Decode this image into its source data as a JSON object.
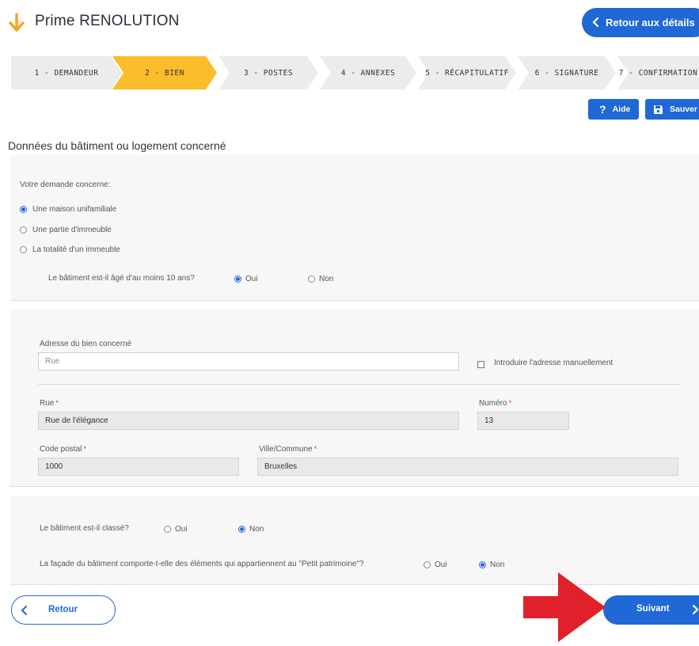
{
  "header": {
    "title": "Prime RENOLUTION",
    "back_details_label": "Retour aux détails"
  },
  "steps": [
    {
      "label": "1 - DEMANDEUR",
      "active": false
    },
    {
      "label": "2 - BIEN",
      "active": true
    },
    {
      "label": "3 - POSTES",
      "active": false
    },
    {
      "label": "4 - ANNEXES",
      "active": false
    },
    {
      "label": "5 - RÉCAPITULATIF",
      "active": false
    },
    {
      "label": "6 - SIGNATURE",
      "active": false
    },
    {
      "label": "7 - CONFIRMATION",
      "active": false
    }
  ],
  "toolbar": {
    "help_label": "Aide",
    "save_label": "Sauver"
  },
  "section_title": "Données du bâtiment ou logement concerné",
  "concern": {
    "label": "Votre demande concerne:",
    "options": [
      {
        "label": "Une maison unifamiliale",
        "selected": true
      },
      {
        "label": "Une partie d'immeuble",
        "selected": false
      },
      {
        "label": "La totalité d'un immeuble",
        "selected": false
      }
    ]
  },
  "age_question": {
    "label": "Le bâtiment est-il âgé d'au moins 10 ans?",
    "yes": "Oui",
    "no": "Non",
    "value": "Oui"
  },
  "address": {
    "label": "Adresse du bien concerné",
    "placeholder": "Rue",
    "manual_label": "Introduire l'adresse manuellement",
    "street_label": "Rue",
    "street_value": "Rue de l'élégance",
    "number_label": "Numéro",
    "number_value": "13",
    "postal_label": "Code postal",
    "postal_value": "1000",
    "city_label": "Ville/Commune",
    "city_value": "Bruxelles",
    "required_mark": "*"
  },
  "classified_question": {
    "label": "Le bâtiment est-il classé?",
    "yes": "Oui",
    "no": "Non",
    "value": "Non"
  },
  "heritage_question": {
    "label": "La façade du bâtiment comporte-t-elle des éléments qui appartiennent au \"Petit patrimoine\"?",
    "yes": "Oui",
    "no": "Non",
    "value": "Non"
  },
  "footer": {
    "back_label": "Retour",
    "next_label": "Suivant"
  },
  "colors": {
    "primary": "#1f68d6",
    "active_step": "#fbbd2a",
    "step_bg": "#ececec",
    "required": "#e0303a",
    "annotation_arrow": "#e0202a"
  }
}
